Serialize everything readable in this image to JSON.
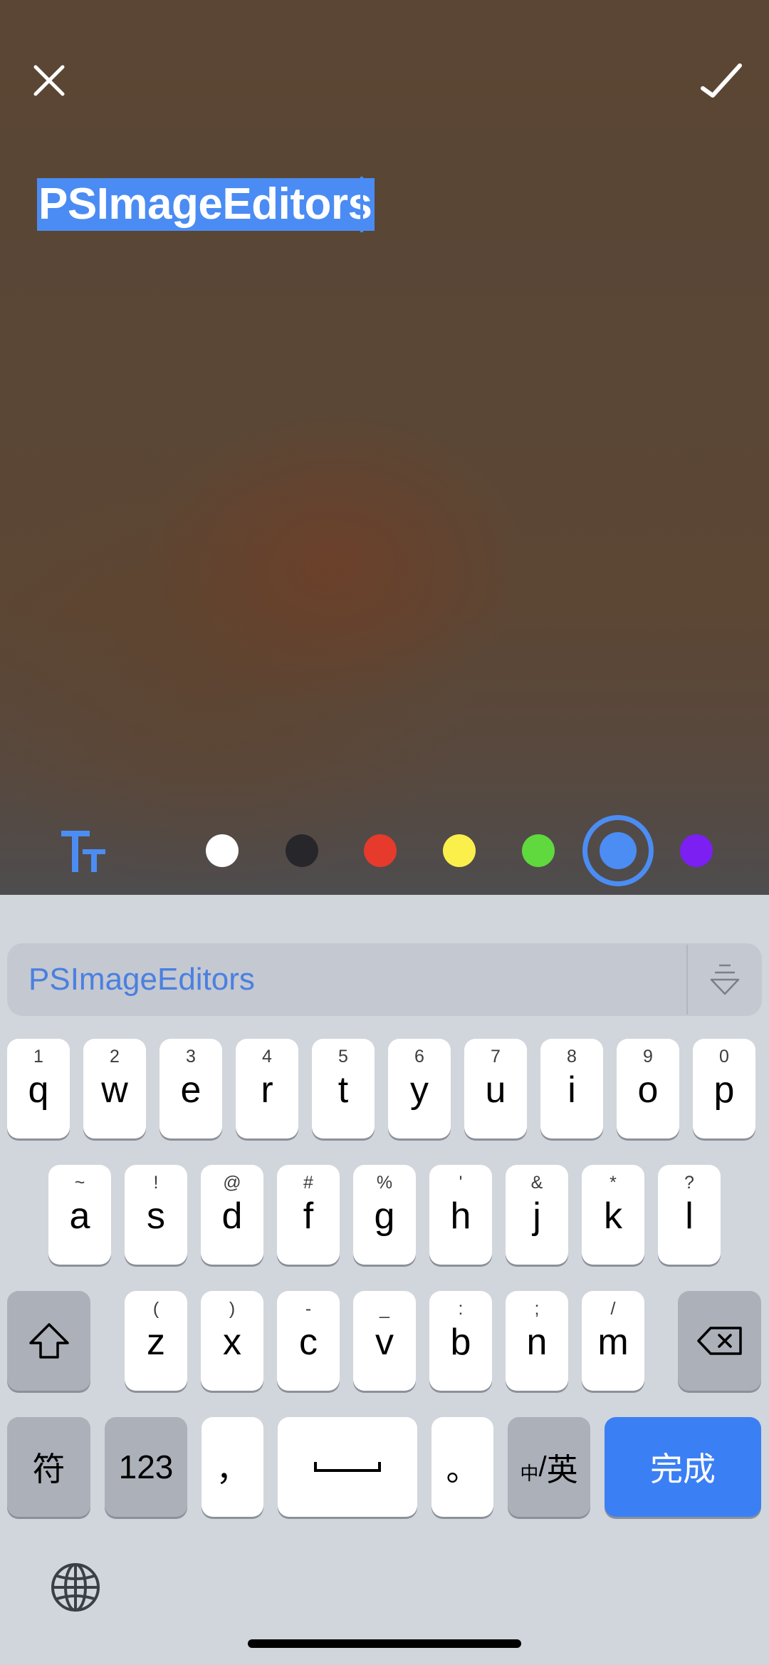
{
  "editor": {
    "caption_text": "PSImageEditors",
    "selection_color": "#4a8cf3"
  },
  "toolbar": {
    "close_icon": "close-icon",
    "confirm_icon": "checkmark-icon",
    "text_style_icon": "text-size-icon",
    "colors": [
      "#ffffff",
      "#27272b",
      "#e63a2d",
      "#fbef4c",
      "#5fd93e",
      "#4b8df3",
      "#7b1ff3"
    ],
    "selected_color": "#4b8df3"
  },
  "keyboard": {
    "suggestion": "PSImageEditors",
    "row1": [
      {
        "hint": "1",
        "key": "q"
      },
      {
        "hint": "2",
        "key": "w"
      },
      {
        "hint": "3",
        "key": "e"
      },
      {
        "hint": "4",
        "key": "r"
      },
      {
        "hint": "5",
        "key": "t"
      },
      {
        "hint": "6",
        "key": "y"
      },
      {
        "hint": "7",
        "key": "u"
      },
      {
        "hint": "8",
        "key": "i"
      },
      {
        "hint": "9",
        "key": "o"
      },
      {
        "hint": "0",
        "key": "p"
      }
    ],
    "row2": [
      {
        "hint": "~",
        "key": "a"
      },
      {
        "hint": "!",
        "key": "s"
      },
      {
        "hint": "@",
        "key": "d"
      },
      {
        "hint": "#",
        "key": "f"
      },
      {
        "hint": "%",
        "key": "g"
      },
      {
        "hint": "'",
        "key": "h"
      },
      {
        "hint": "&",
        "key": "j"
      },
      {
        "hint": "*",
        "key": "k"
      },
      {
        "hint": "?",
        "key": "l"
      }
    ],
    "row3": [
      {
        "hint": "(",
        "key": "z"
      },
      {
        "hint": ")",
        "key": "x"
      },
      {
        "hint": "-",
        "key": "c"
      },
      {
        "hint": "_",
        "key": "v"
      },
      {
        "hint": ":",
        "key": "b"
      },
      {
        "hint": ";",
        "key": "n"
      },
      {
        "hint": "/",
        "key": "m"
      }
    ],
    "symbols_label": "符",
    "numbers_label": "123",
    "comma_label": "，",
    "period_label": "。",
    "lang_small": "中",
    "lang_slash": "/",
    "lang_large": "英",
    "done_label": "完成"
  }
}
